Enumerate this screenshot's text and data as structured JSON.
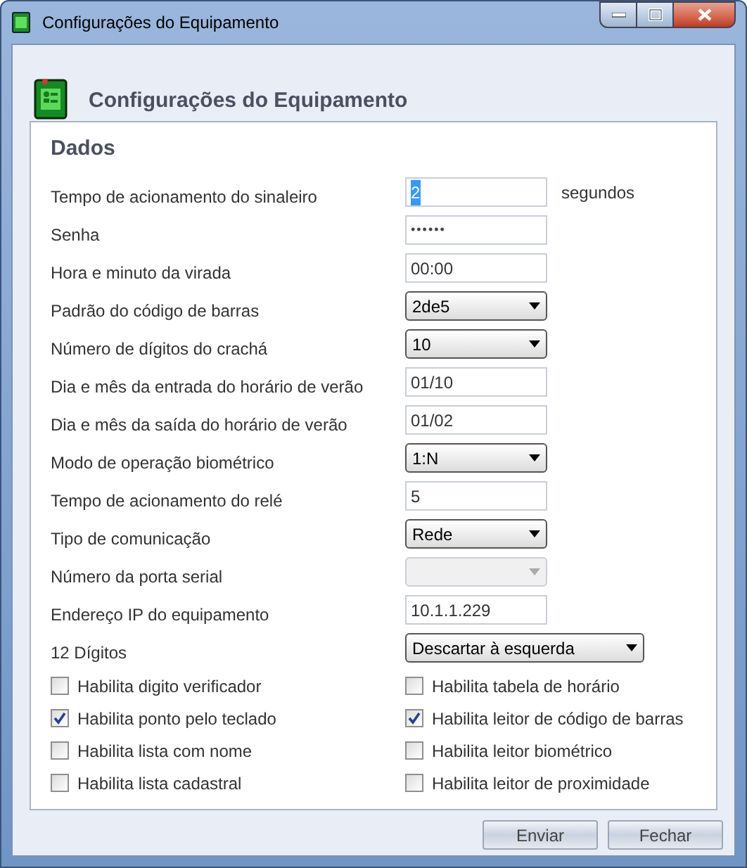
{
  "window": {
    "title": "Configurações do Equipamento"
  },
  "header": {
    "title": "Configurações do Equipamento"
  },
  "panel": {
    "title": "Dados",
    "fields": [
      {
        "kind": "text",
        "label": "Tempo de acionamento do sinaleiro",
        "value": "2",
        "highlighted": true,
        "suffix": "segundos"
      },
      {
        "kind": "password",
        "label": "Senha",
        "value": "••••••"
      },
      {
        "kind": "text",
        "label": "Hora e minuto da virada",
        "value": "00:00"
      },
      {
        "kind": "select",
        "label": "Padrão do código de barras",
        "value": "2de5"
      },
      {
        "kind": "select",
        "label": "Número de dígitos do crachá",
        "value": "10"
      },
      {
        "kind": "text",
        "label": "Dia e mês da entrada do horário de verão",
        "value": "01/10"
      },
      {
        "kind": "text",
        "label": "Dia e mês da saída do horário de verão",
        "value": "01/02"
      },
      {
        "kind": "select",
        "label": "Modo de operação biométrico",
        "value": "1:N"
      },
      {
        "kind": "text",
        "label": "Tempo de acionamento do relé",
        "value": "5"
      },
      {
        "kind": "select",
        "label": "Tipo de comunicação",
        "value": "Rede"
      },
      {
        "kind": "select",
        "label": "Número da porta serial",
        "disabled": true
      },
      {
        "kind": "text",
        "label": "Endereço IP do equipamento",
        "value": "10.1.1.229"
      },
      {
        "kind": "wide-select",
        "label": "12 Dígitos",
        "value": "Descartar à esquerda"
      }
    ],
    "checkboxes": [
      {
        "label": "Habilita digito verificador",
        "checked": false
      },
      {
        "label": "Habilita tabela de horário",
        "checked": false
      },
      {
        "label": "Habilita ponto pelo teclado",
        "checked": true
      },
      {
        "label": "Habilita leitor de código de barras",
        "checked": true
      },
      {
        "label": "Habilita lista com nome",
        "checked": false
      },
      {
        "label": "Habilita leitor biométrico",
        "checked": false
      },
      {
        "label": "Habilita lista cadastral",
        "checked": false
      },
      {
        "label": "Habilita leitor de proximidade",
        "checked": false
      }
    ]
  },
  "buttons": [
    {
      "label": "Enviar"
    },
    {
      "label": "Fechar"
    }
  ]
}
